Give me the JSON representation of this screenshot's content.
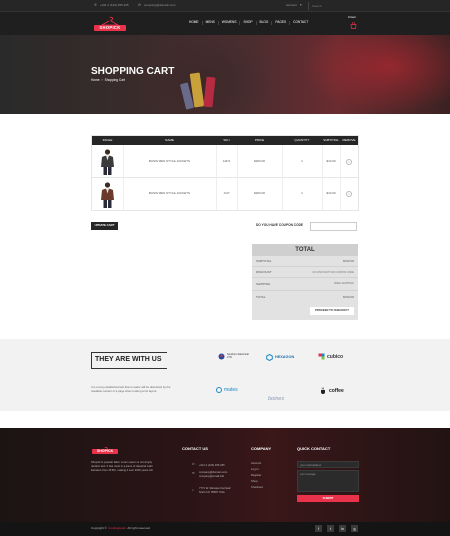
{
  "topbar": {
    "phone": "+011 2 (123) 456 325",
    "email": "company@domain.com",
    "account": "Account",
    "search_placeholder": "Search"
  },
  "header": {
    "logo": "SHOPICK",
    "nav": [
      "HOME",
      "MENS",
      "WOMENS",
      "SHOP",
      "BLOG",
      "PAGES",
      "CONTACT"
    ],
    "cart_count": "0 item"
  },
  "hero": {
    "title": "SHOPPING CART",
    "breadcrumb_home": "Home",
    "breadcrumb_current": "Shopping Cart"
  },
  "cart": {
    "headers": [
      "IMAGE",
      "NAME",
      "SKU",
      "PRICE",
      "QUANTITY",
      "SUBTOTAL",
      "REMOVE"
    ],
    "rows": [
      {
        "name": "BASIS MEN STYLE JACKETS",
        "sku": "JJ471",
        "price": "$200.00",
        "qty": "1",
        "subtotal": "$10.00"
      },
      {
        "name": "BASIS MEN STYLE JACKETS",
        "sku": "JJ17",
        "price": "$200.00",
        "qty": "1",
        "subtotal": "$10.00"
      }
    ],
    "update_label": "UPDATE CART",
    "coupon_label": "DO YOU HAVE COUPON CODE"
  },
  "totals": {
    "title": "TOTAL",
    "subtotal_label": "SUBTOTAL",
    "subtotal_value": "$700.00",
    "discount_label": "DISCOUNT",
    "discount_value": "NO DISCOUNT OR COUPON CODE",
    "shipping_label": "SHIPPING",
    "shipping_value": "FREE SHIPPING",
    "total_label": "TOTAL",
    "total_value": "$700.00",
    "checkout_label": "PROCEED TO CHECKOUT"
  },
  "partners": {
    "heading": "THEY ARE WITH US",
    "desc_line1": "It is a long established fact that a reader will be distracted by the",
    "desc_line2": "readable content of a page when looking at its layout.",
    "logos": [
      "Southern Electrical LTD",
      "HEXAGON",
      "cubico",
      "mates",
      "boines",
      "coffee"
    ]
  },
  "footer": {
    "logo": "SHOPICK",
    "about_line1": "Shopick is popular label. Lorem ipsum is not simply",
    "about_line2": "random text. It has roots in a piece of classical Latin",
    "about_line3": "literature from 45 BC, making it over 2000 years old.",
    "contact_title": "CONTACT US",
    "contact_phone": "+011 2 (123) 456 325",
    "contact_email1": "company@domain.com",
    "contact_email2": "company@email.info",
    "contact_addr1": "7771 W. Ramapo Fernleaf",
    "contact_addr2": "North UC 55667 USA",
    "company_title": "COMPANY",
    "company_links": [
      "Account",
      "Log in",
      "Register",
      "Shop",
      "Checkout"
    ],
    "quick_title": "QUICK CONTACT",
    "quick_email": "your email address",
    "quick_message": "your message",
    "submit_label": "SUBMIT"
  },
  "copyright": {
    "prefix": "Copyright ©",
    "brand": "Codingstudio",
    "suffix": "All right reserved",
    "social": [
      "f",
      "t",
      "in",
      "g"
    ]
  },
  "colors": {
    "accent": "#e8334a",
    "dark": "#1f1f1f"
  }
}
